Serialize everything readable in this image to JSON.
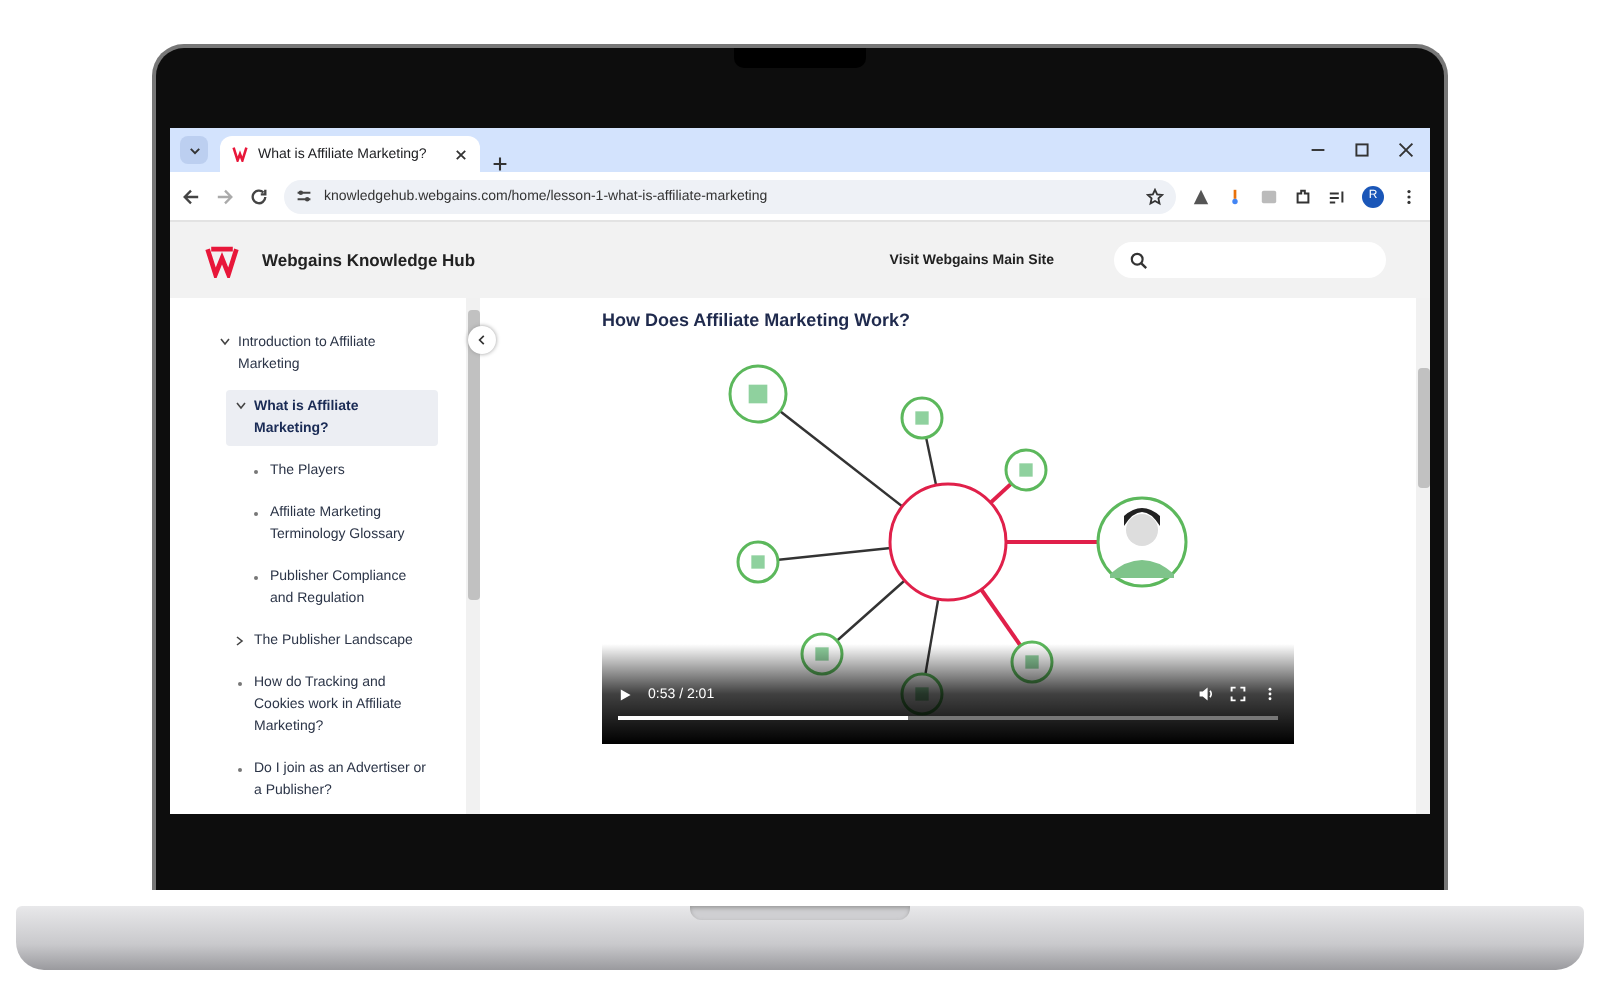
{
  "browser": {
    "tab_title": "What is Affiliate Marketing?",
    "url": "knowledgehub.webgains.com/home/lesson-1-what-is-affiliate-marketing",
    "profile_initial": "R"
  },
  "site_header": {
    "brand": "Webgains Knowledge Hub",
    "main_site_link": "Visit Webgains Main Site"
  },
  "sidebar": {
    "items": [
      {
        "label": "Introduction to Affiliate Marketing",
        "kind": "group",
        "expanded": true,
        "selected": false,
        "children": [
          {
            "label": "What is Affiliate Marketing?",
            "kind": "group",
            "expanded": true,
            "selected": true,
            "children": [
              {
                "label": "The Players",
                "kind": "page",
                "selected": false
              },
              {
                "label": "Affiliate Marketing Terminology Glossary",
                "kind": "page",
                "selected": false
              },
              {
                "label": "Publisher Compliance and Regulation",
                "kind": "page",
                "selected": false
              }
            ]
          },
          {
            "label": "The Publisher Landscape",
            "kind": "group",
            "expanded": false,
            "selected": false
          },
          {
            "label": "How do Tracking and Cookies work in Affiliate Marketing?",
            "kind": "page",
            "selected": false
          },
          {
            "label": "Do I join as an Advertiser or a Publisher?",
            "kind": "page",
            "selected": false
          }
        ]
      }
    ]
  },
  "content": {
    "title": "How Does Affiliate Marketing Work?",
    "video": {
      "kind": "picture",
      "time": "0:53 / 2:01",
      "level": 0.44
    }
  }
}
